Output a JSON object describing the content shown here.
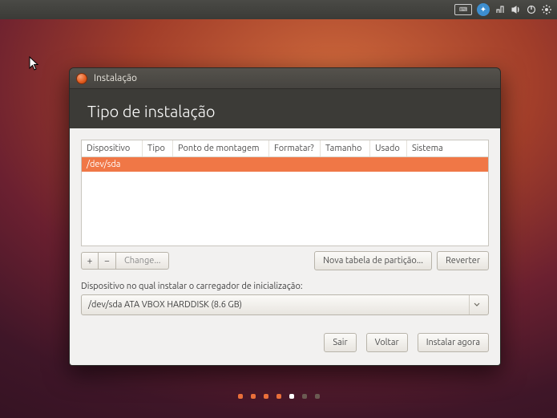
{
  "panel": {
    "indicators": [
      "keyboard",
      "accessibility",
      "network",
      "sound",
      "power",
      "settings"
    ]
  },
  "window": {
    "title": "Instalação",
    "page_title": "Tipo de instalação"
  },
  "partition_table": {
    "headers": {
      "device": "Dispositivo",
      "type": "Tipo",
      "mount": "Ponto de montagem",
      "format": "Formatar?",
      "size": "Tamanho",
      "used": "Usado",
      "system": "Sistema"
    },
    "rows": [
      {
        "device": "/dev/sda",
        "type": "",
        "mount": "",
        "format": "",
        "size": "",
        "used": "",
        "system": "",
        "selected": true
      }
    ]
  },
  "table_toolbar": {
    "add": "+",
    "remove": "−",
    "change": "Change...",
    "new_table": "Nova tabela de partição...",
    "revert": "Reverter"
  },
  "bootloader": {
    "label": "Dispositivo no qual instalar o carregador de inicialização:",
    "selected": "/dev/sda  ATA VBOX HARDDISK (8.6 GB)"
  },
  "footer": {
    "quit": "Sair",
    "back": "Voltar",
    "install": "Instalar agora"
  },
  "progress": {
    "total": 7,
    "completed": 4,
    "current_index": 4
  },
  "colors": {
    "accent": "#f07746",
    "panel_bg": "#3c3b37"
  }
}
